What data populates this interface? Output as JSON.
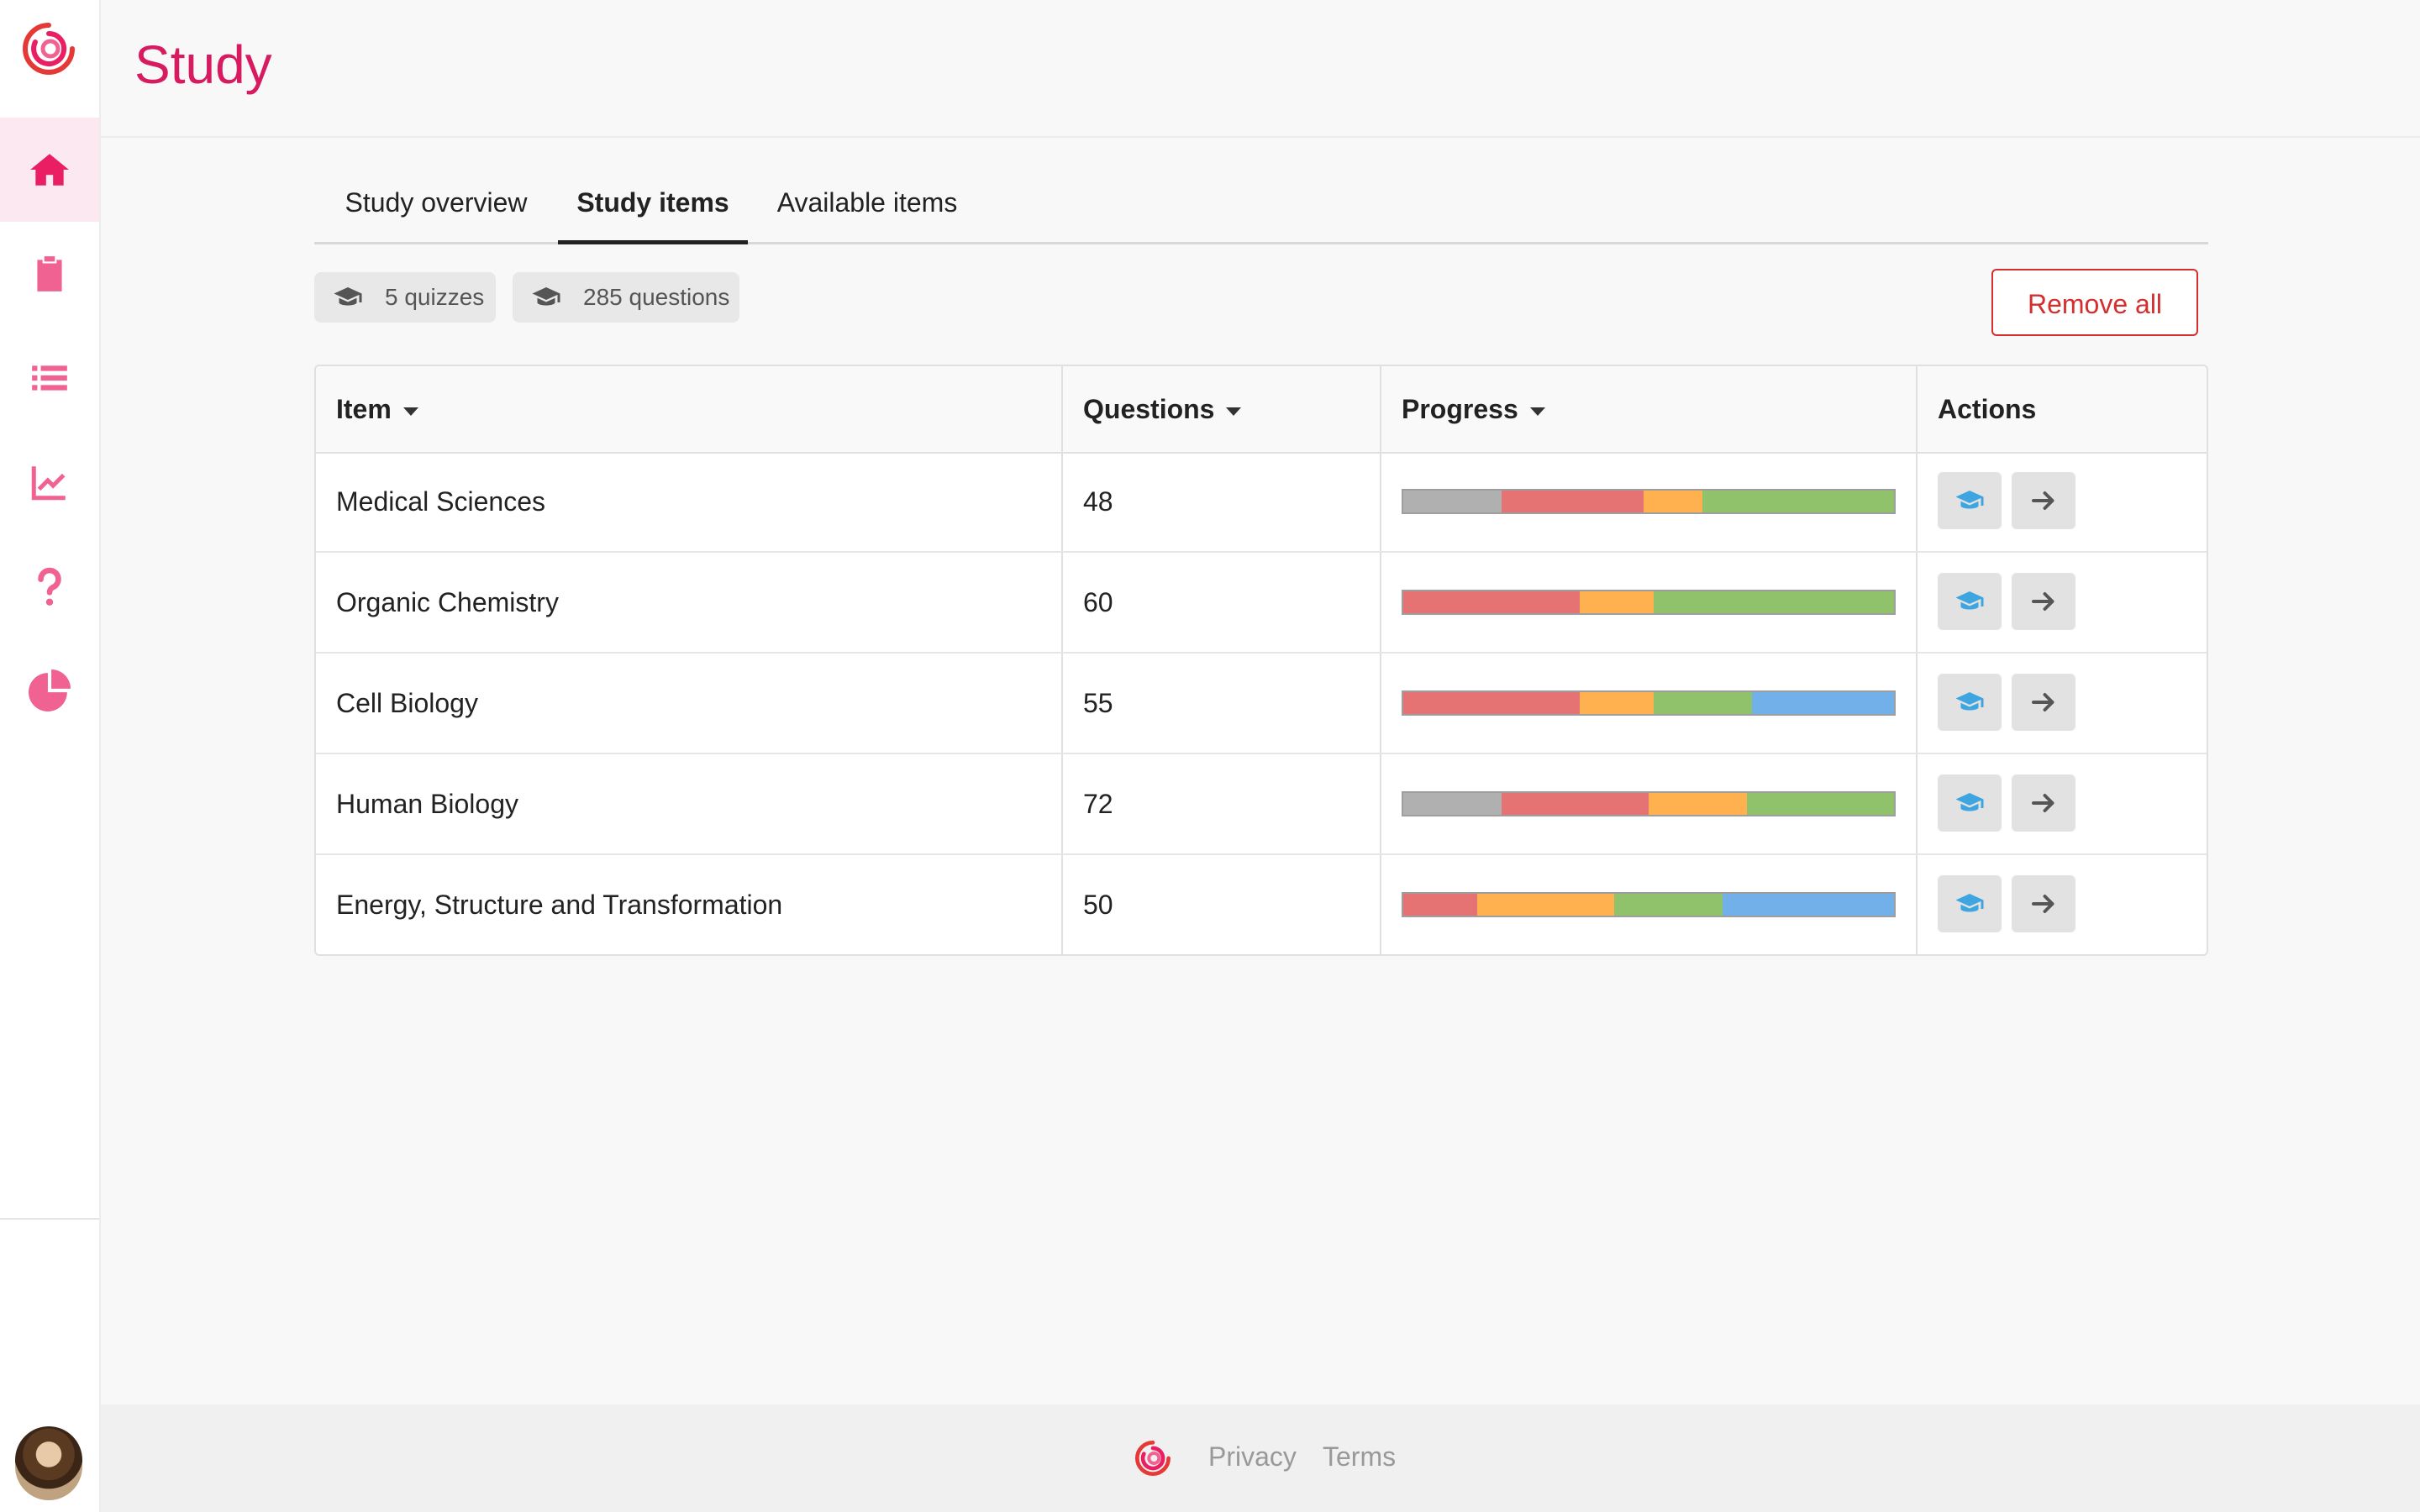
{
  "app": {
    "title": "Study"
  },
  "colors": {
    "brand": "#d81b60",
    "nav_icon": "#e91e63",
    "remove": "#d32f2f",
    "progress_gray": "#b0b0b0",
    "progress_red": "#e57373",
    "progress_orange": "#ffb04f",
    "progress_green": "#8fc26a",
    "progress_blue": "#72b0ea",
    "study_icon": "#3fa5e0"
  },
  "sidebar": {
    "items": [
      {
        "icon": "home-icon",
        "active": true
      },
      {
        "icon": "clipboard-icon",
        "active": false
      },
      {
        "icon": "list-icon",
        "active": false
      },
      {
        "icon": "chart-line-icon",
        "active": false
      },
      {
        "icon": "question-icon",
        "active": false
      },
      {
        "icon": "pie-chart-icon",
        "active": false
      }
    ]
  },
  "tabs": [
    {
      "label": "Study overview",
      "active": false
    },
    {
      "label": "Study items",
      "active": true
    },
    {
      "label": "Available items",
      "active": false
    }
  ],
  "badges": {
    "quizzes": "5 quizzes",
    "questions": "285 questions"
  },
  "remove_all_label": "Remove all",
  "table": {
    "headers": {
      "item": "Item",
      "questions": "Questions",
      "progress": "Progress",
      "actions": "Actions"
    },
    "rows": [
      {
        "item": "Medical Sciences",
        "questions": "48",
        "progress": {
          "gray": 0.2,
          "red": 0.29,
          "orange": 0.12,
          "green": 0.39,
          "blue": 0
        }
      },
      {
        "item": "Organic Chemistry",
        "questions": "60",
        "progress": {
          "gray": 0,
          "red": 0.36,
          "orange": 0.15,
          "green": 0.49,
          "blue": 0
        }
      },
      {
        "item": "Cell Biology",
        "questions": "55",
        "progress": {
          "gray": 0,
          "red": 0.36,
          "orange": 0.15,
          "green": 0.2,
          "blue": 0.29
        }
      },
      {
        "item": "Human Biology",
        "questions": "72",
        "progress": {
          "gray": 0.2,
          "red": 0.3,
          "orange": 0.2,
          "green": 0.3,
          "blue": 0
        }
      },
      {
        "item": "Energy, Structure and Transformation",
        "questions": "50",
        "progress": {
          "gray": 0,
          "red": 0.15,
          "orange": 0.28,
          "green": 0.22,
          "blue": 0.35
        }
      }
    ]
  },
  "footer": {
    "privacy": "Privacy",
    "terms": "Terms"
  }
}
